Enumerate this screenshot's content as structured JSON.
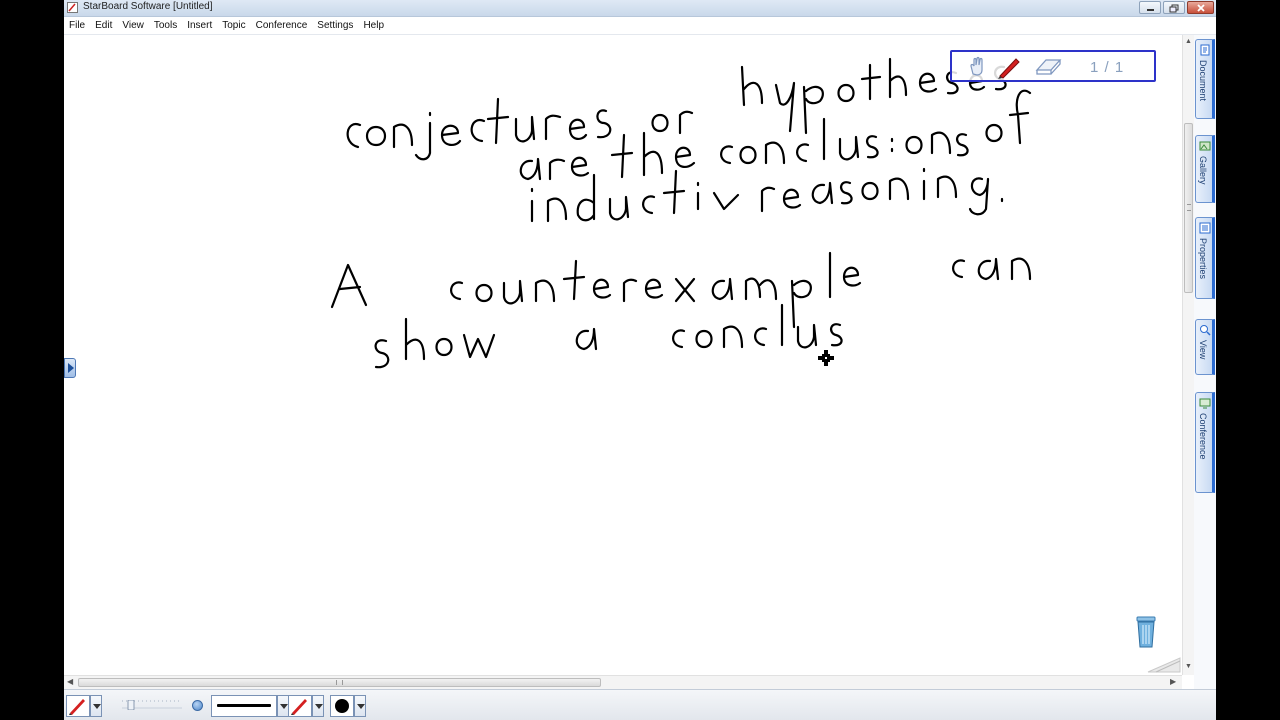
{
  "window": {
    "title": "StarBoard Software [Untitled]"
  },
  "menu": {
    "items": [
      "File",
      "Edit",
      "View",
      "Tools",
      "Insert",
      "Topic",
      "Conference",
      "Settings",
      "Help"
    ]
  },
  "float_toolbar": {
    "page_indicator": "1 / 1",
    "icons": [
      "hand-icon",
      "pen-icon",
      "eraser-icon"
    ]
  },
  "canvas": {
    "handwritten_text": {
      "line_1": "conjectures or hypotheses",
      "line_2": "are the conclusions of",
      "line_3": "inductive reasoning.",
      "line_4": "A counterexample can",
      "line_5": "show a conclus"
    },
    "cursor": "move-cursor-icon"
  },
  "side_tabs": {
    "items": [
      {
        "label": "Document",
        "icon": "document-icon"
      },
      {
        "label": "Gallery",
        "icon": "gallery-icon"
      },
      {
        "label": "Properties",
        "icon": "properties-icon"
      },
      {
        "label": "View",
        "icon": "view-icon"
      },
      {
        "label": "Conference",
        "icon": "conference-icon"
      }
    ]
  },
  "bottom_toolbar": {
    "pen_color": "#d42020",
    "line_color": "#000000",
    "fill_color": "#000000"
  },
  "colors": {
    "accent": "#2b6bd0",
    "float_toolbar_border": "#2d32c9",
    "ink": "#000000"
  }
}
